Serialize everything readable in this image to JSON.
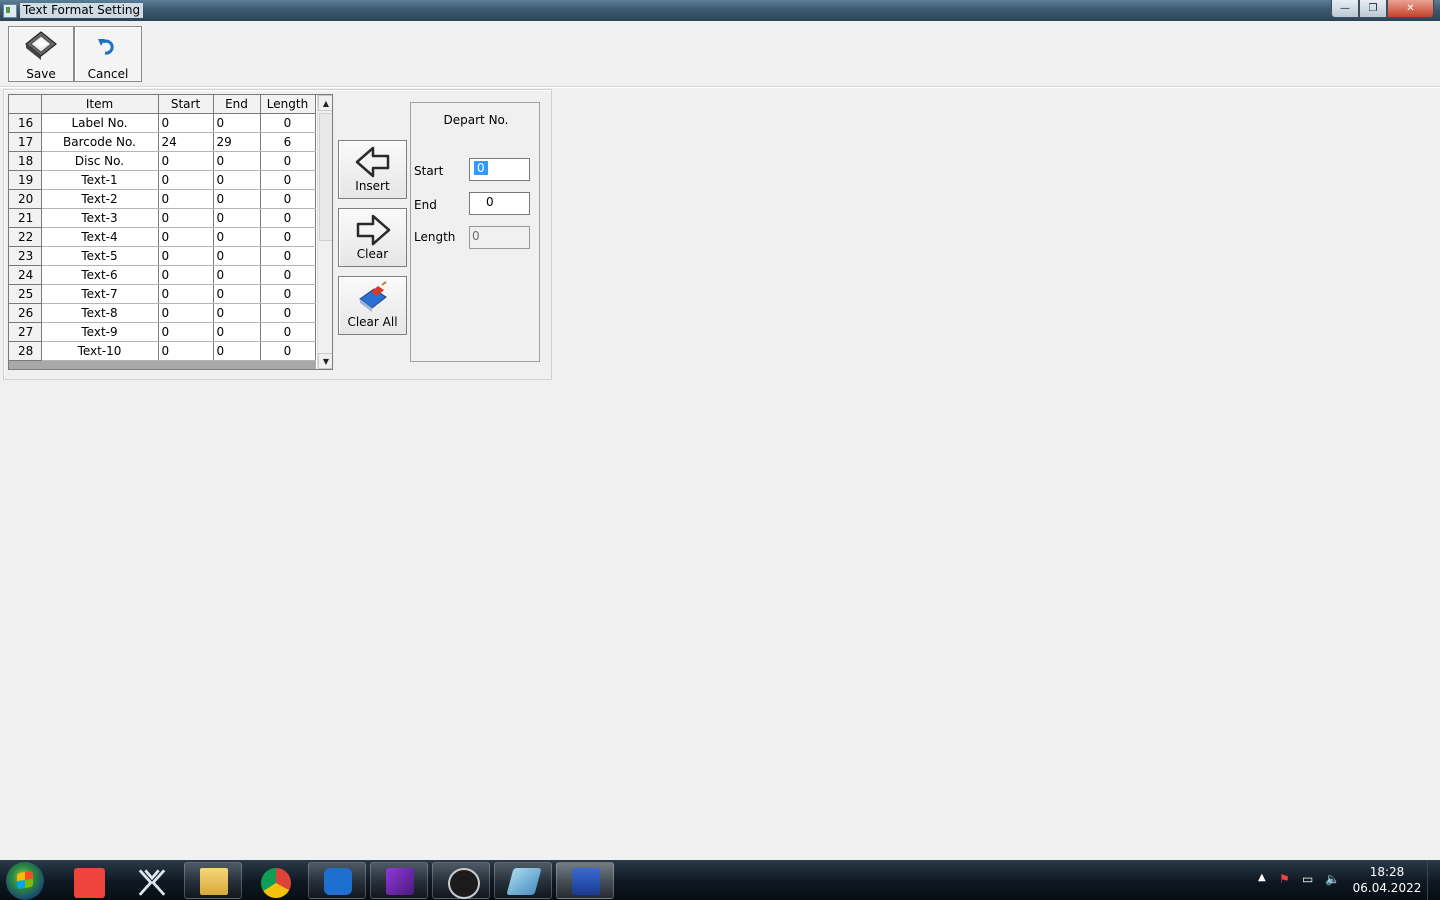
{
  "window": {
    "title": "Text Format Setting",
    "buttons": {
      "minimize": "—",
      "restore": "❐",
      "close": "✕"
    }
  },
  "toolbar": {
    "save_label": "Save",
    "cancel_label": "Cancel"
  },
  "grid": {
    "columns": [
      "",
      "Item",
      "Start",
      "End",
      "Length"
    ],
    "rows": [
      {
        "no": "16",
        "item": "Label No.",
        "start": "0",
        "end": "0",
        "length": "0"
      },
      {
        "no": "17",
        "item": "Barcode No.",
        "start": "24",
        "end": "29",
        "length": "6"
      },
      {
        "no": "18",
        "item": "Disc No.",
        "start": "0",
        "end": "0",
        "length": "0"
      },
      {
        "no": "19",
        "item": "Text-1",
        "start": "0",
        "end": "0",
        "length": "0"
      },
      {
        "no": "20",
        "item": "Text-2",
        "start": "0",
        "end": "0",
        "length": "0"
      },
      {
        "no": "21",
        "item": "Text-3",
        "start": "0",
        "end": "0",
        "length": "0"
      },
      {
        "no": "22",
        "item": "Text-4",
        "start": "0",
        "end": "0",
        "length": "0"
      },
      {
        "no": "23",
        "item": "Text-5",
        "start": "0",
        "end": "0",
        "length": "0"
      },
      {
        "no": "24",
        "item": "Text-6",
        "start": "0",
        "end": "0",
        "length": "0"
      },
      {
        "no": "25",
        "item": "Text-7",
        "start": "0",
        "end": "0",
        "length": "0"
      },
      {
        "no": "26",
        "item": "Text-8",
        "start": "0",
        "end": "0",
        "length": "0"
      },
      {
        "no": "27",
        "item": "Text-9",
        "start": "0",
        "end": "0",
        "length": "0"
      },
      {
        "no": "28",
        "item": "Text-10",
        "start": "0",
        "end": "0",
        "length": "0"
      }
    ]
  },
  "actions": {
    "insert_label": "Insert",
    "clear_label": "Clear",
    "clear_all_label": "Clear All"
  },
  "depart": {
    "title": "Depart No.",
    "start_label": "Start",
    "start_value": "0",
    "end_label": "End",
    "end_value": "0",
    "length_label": "Length",
    "length_value": "0"
  },
  "taskbar": {
    "time": "18:28",
    "date": "06.04.2022",
    "apps": [
      "start-orb",
      "anydesk",
      "respos",
      "file-explorer",
      "chrome",
      "s-app",
      "purple-app",
      "densi",
      "blue-app",
      "active-app"
    ]
  },
  "colors": {
    "selection": "#3399ff",
    "background": "#f0f0f0"
  }
}
